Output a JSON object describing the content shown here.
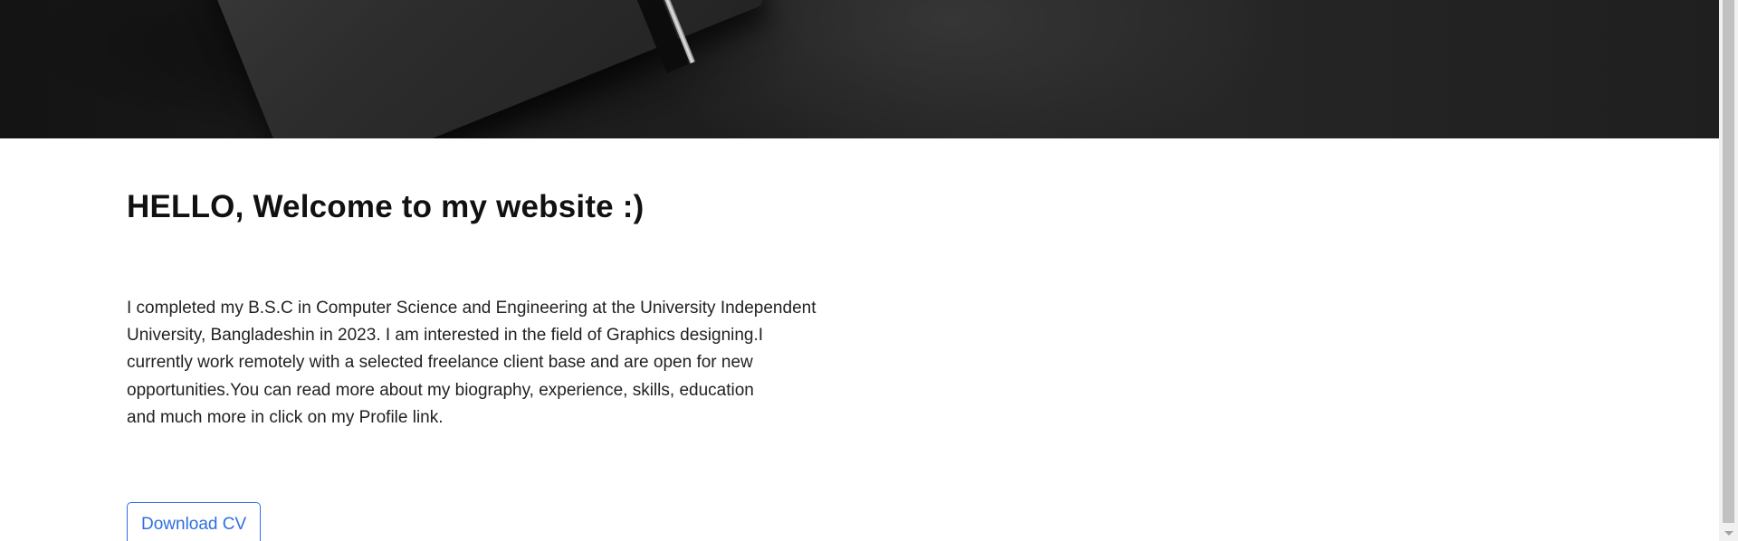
{
  "hero": {
    "image_name": "dark-notebook-photo"
  },
  "main": {
    "heading": "HELLO, Welcome to my website :)",
    "bio_lines": [
      "I completed my B.S.C in Computer Science and Engineering at the University Independent",
      "University, Bangladeshin in 2023. I am interested in the field of Graphics designing.I",
      "currently work remotely with a selected freelance client base and are open for new",
      "opportunities.You can read more about my biography, experience, skills, education",
      "and much more in click on my Profile link."
    ],
    "download_button_label": "Download CV"
  },
  "colors": {
    "accent": "#2f6fe0",
    "heading": "#111111",
    "body_text": "#222222",
    "hero_dark": "#1e1e1e"
  }
}
